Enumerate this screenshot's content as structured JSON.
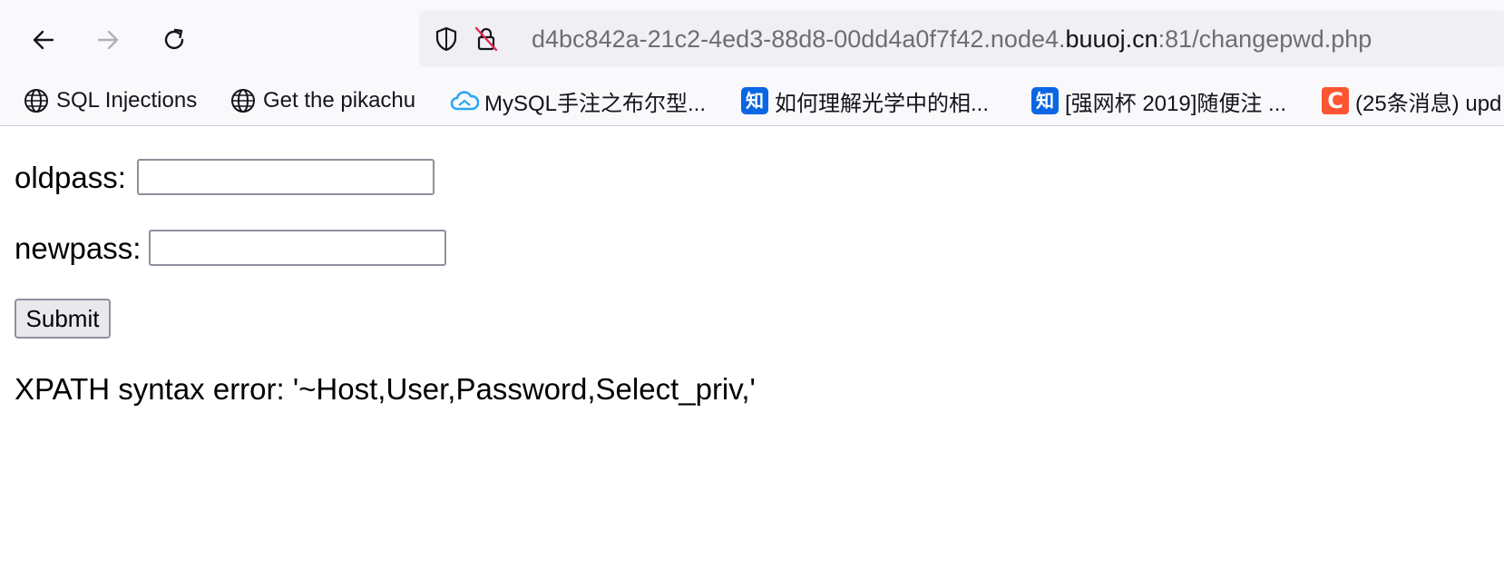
{
  "nav": {
    "back_icon": "arrow-left-icon",
    "forward_icon": "arrow-right-icon",
    "reload_icon": "reload-icon"
  },
  "urlbar": {
    "shield_icon": "tracking-protection-shield-icon",
    "lock_icon": "insecure-lock-icon",
    "url_prefix": "d4bc842a-21c2-4ed3-88d8-00dd4a0f7f42.node4.",
    "url_domain": "buuoj.cn",
    "url_suffix": ":81/changepwd.php"
  },
  "bookmarks": [
    {
      "label": "SQL Injections",
      "icon": "globe-icon"
    },
    {
      "label": "Get the pikachu",
      "icon": "globe-icon"
    },
    {
      "label": "MySQL手注之布尔型...",
      "icon": "cloud-icon"
    },
    {
      "label": "如何理解光学中的相...",
      "icon": "zhihu-icon",
      "icon_text": "知"
    },
    {
      "label": "[强网杯 2019]随便注 ...",
      "icon": "zhihu-icon",
      "icon_text": "知"
    },
    {
      "label": "(25条消息) upd",
      "icon": "csdn-icon",
      "icon_text": "C"
    }
  ],
  "form": {
    "oldpass_label": "oldpass:",
    "oldpass_value": "",
    "newpass_label": "newpass:",
    "newpass_value": "",
    "submit_label": "Submit"
  },
  "message": "XPATH syntax error: '~Host,User,Password,Select_priv,'",
  "colors": {
    "zhihu": "#0a66e2",
    "csdn": "#fc5531",
    "cloud": "#2aa7f5",
    "lock_slash": "#e22850"
  }
}
